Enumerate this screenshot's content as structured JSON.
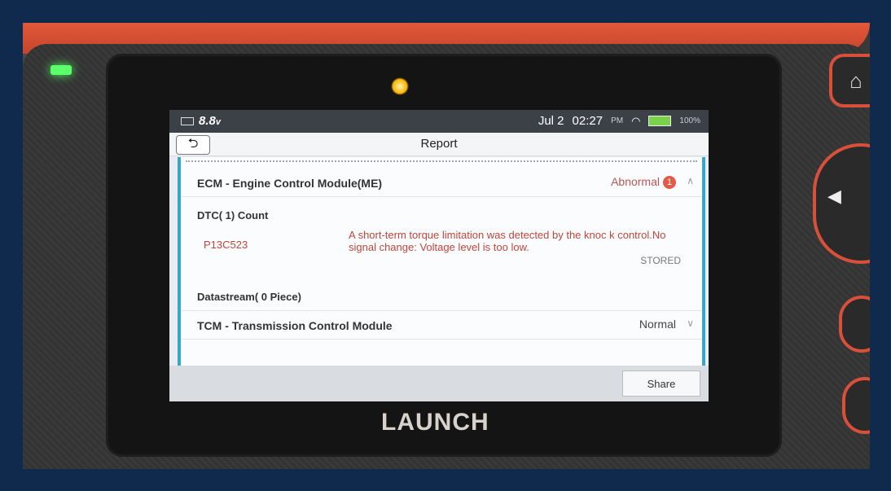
{
  "device": {
    "brand": "LAUNCH"
  },
  "statusbar": {
    "voltage": "8.8",
    "voltage_unit": "v",
    "date": "Jul 2",
    "time": "02:27",
    "ampm": "PM",
    "battery": "100%"
  },
  "titlebar": {
    "title": "Report",
    "back_icon": "back-arrow-icon"
  },
  "report": {
    "modules": [
      {
        "name": "ECM - Engine Control Module(ME)",
        "status": "Abnormal",
        "badge": "1",
        "dtc_count_label": "DTC( 1) Count",
        "dtcs": [
          {
            "code": "P13C523",
            "description": "A short-term torque limitation was detected by the knoc k control.No signal change: Voltage level is too low.",
            "state": "STORED"
          }
        ],
        "datastream_label": "Datastream( 0 Piece)"
      },
      {
        "name": "TCM - Transmission Control Module",
        "status": "Normal"
      }
    ]
  },
  "footer": {
    "share_label": "Share"
  },
  "colors": {
    "accent": "#3aa6c2",
    "abnormal": "#c0463b",
    "device_trim": "#d9503a"
  }
}
